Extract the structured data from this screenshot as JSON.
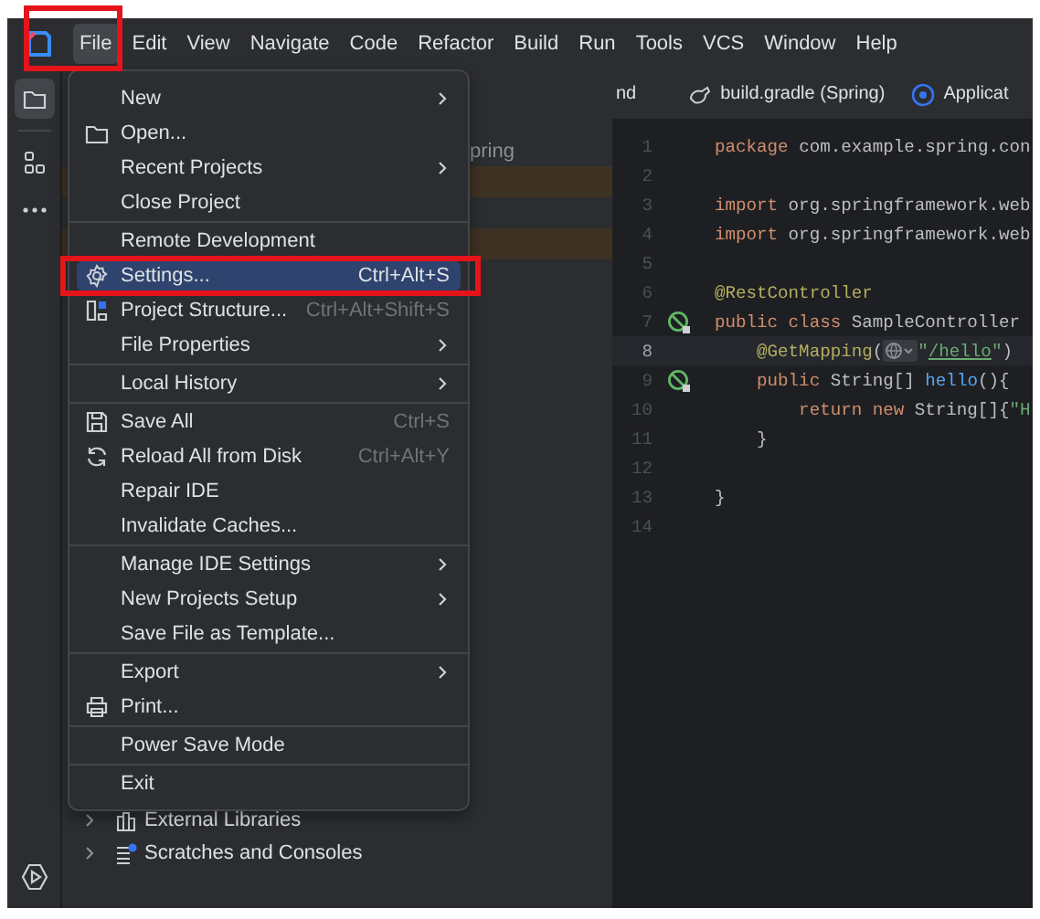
{
  "menubar": {
    "items": [
      {
        "label": "File",
        "selected": true
      },
      {
        "label": "Edit",
        "selected": false
      },
      {
        "label": "View",
        "selected": false
      },
      {
        "label": "Navigate",
        "selected": false
      },
      {
        "label": "Code",
        "selected": false
      },
      {
        "label": "Refactor",
        "selected": false
      },
      {
        "label": "Build",
        "selected": false
      },
      {
        "label": "Run",
        "selected": false
      },
      {
        "label": "Tools",
        "selected": false
      },
      {
        "label": "VCS",
        "selected": false
      },
      {
        "label": "Window",
        "selected": false
      },
      {
        "label": "Help",
        "selected": false
      }
    ]
  },
  "file_menu": {
    "items": [
      {
        "kind": "item",
        "label": "New",
        "submenu": true,
        "selected": false
      },
      {
        "kind": "item",
        "label": "Open...",
        "submenu": false,
        "selected": false
      },
      {
        "kind": "item",
        "label": "Recent Projects",
        "submenu": true,
        "selected": false
      },
      {
        "kind": "item",
        "label": "Close Project",
        "submenu": false,
        "selected": false
      },
      {
        "kind": "separator"
      },
      {
        "kind": "item",
        "label": "Remote Development",
        "submenu": false,
        "selected": false
      },
      {
        "kind": "item",
        "label": "Settings...",
        "shortcut": "Ctrl+Alt+S",
        "submenu": false,
        "selected": true
      },
      {
        "kind": "item",
        "label": "Project Structure...",
        "shortcut": "Ctrl+Alt+Shift+S",
        "submenu": false,
        "selected": false
      },
      {
        "kind": "item",
        "label": "File Properties",
        "submenu": true,
        "selected": false
      },
      {
        "kind": "separator"
      },
      {
        "kind": "item",
        "label": "Local History",
        "submenu": true,
        "selected": false
      },
      {
        "kind": "separator"
      },
      {
        "kind": "item",
        "label": "Save All",
        "shortcut": "Ctrl+S",
        "submenu": false,
        "selected": false
      },
      {
        "kind": "item",
        "label": "Reload All from Disk",
        "shortcut": "Ctrl+Alt+Y",
        "submenu": false,
        "selected": false
      },
      {
        "kind": "item",
        "label": "Repair IDE",
        "submenu": false,
        "selected": false
      },
      {
        "kind": "item",
        "label": "Invalidate Caches...",
        "submenu": false,
        "selected": false
      },
      {
        "kind": "separator"
      },
      {
        "kind": "item",
        "label": "Manage IDE Settings",
        "submenu": true,
        "selected": false
      },
      {
        "kind": "item",
        "label": "New Projects Setup",
        "submenu": true,
        "selected": false
      },
      {
        "kind": "item",
        "label": "Save File as Template...",
        "submenu": false,
        "selected": false
      },
      {
        "kind": "separator"
      },
      {
        "kind": "item",
        "label": "Export",
        "submenu": true,
        "selected": false
      },
      {
        "kind": "item",
        "label": "Print...",
        "submenu": false,
        "selected": false
      },
      {
        "kind": "separator"
      },
      {
        "kind": "item",
        "label": "Power Save Mode",
        "submenu": false,
        "selected": false
      },
      {
        "kind": "separator"
      },
      {
        "kind": "item",
        "label": "Exit",
        "submenu": false,
        "selected": false
      }
    ]
  },
  "project_tree": {
    "rows": [
      {
        "label": "pring",
        "highlighted": false
      },
      {
        "highlighted": true
      },
      {
        "highlighted": false
      },
      {
        "highlighted": true
      }
    ],
    "bottom_rows": [
      {
        "label": "External Libraries",
        "expanded": false
      },
      {
        "label": "Scratches and Consoles",
        "expanded": false
      }
    ]
  },
  "editor": {
    "tabs": [
      {
        "label": "nd",
        "selected": false
      },
      {
        "label": "build.gradle (Spring)",
        "selected": false
      },
      {
        "label": "Applicat",
        "selected": false
      }
    ],
    "lines": [
      {
        "number": "1",
        "current": false,
        "marker": false,
        "tokens": [
          {
            "kind": "keyword",
            "text": "package"
          },
          {
            "kind": "plain",
            "text": " com.example.spring.con"
          }
        ]
      },
      {
        "number": "2",
        "current": false,
        "marker": false
      },
      {
        "number": "3",
        "current": false,
        "marker": false,
        "tokens": [
          {
            "kind": "keyword",
            "text": "import"
          },
          {
            "kind": "plain",
            "text": " org.springframework.web"
          }
        ]
      },
      {
        "number": "4",
        "current": false,
        "marker": false,
        "tokens": [
          {
            "kind": "keyword",
            "text": "import"
          },
          {
            "kind": "plain",
            "text": " org.springframework.web"
          }
        ]
      },
      {
        "number": "5",
        "current": false,
        "marker": false
      },
      {
        "number": "6",
        "current": false,
        "marker": false,
        "tokens": [
          {
            "kind": "annotation",
            "text": "@RestController"
          }
        ]
      },
      {
        "number": "7",
        "current": false,
        "marker": true,
        "tokens": [
          {
            "kind": "keyword",
            "text": "public class "
          },
          {
            "kind": "plain",
            "text": "SampleController"
          }
        ]
      },
      {
        "number": "8",
        "current": true,
        "marker": false,
        "tokens": [
          {
            "kind": "annotation",
            "text": "    @GetMapping"
          },
          {
            "kind": "plain",
            "text": "("
          },
          {
            "kind": "inlay"
          },
          {
            "kind": "string",
            "text": "\""
          },
          {
            "kind": "link",
            "text": "/hello"
          },
          {
            "kind": "string",
            "text": "\""
          },
          {
            "kind": "plain",
            "text": ")"
          }
        ]
      },
      {
        "number": "9",
        "current": false,
        "marker": true,
        "tokens": [
          {
            "kind": "keyword",
            "text": "    public "
          },
          {
            "kind": "plain",
            "text": "String[] "
          },
          {
            "kind": "method",
            "text": "hello"
          },
          {
            "kind": "plain",
            "text": "(){"
          }
        ]
      },
      {
        "number": "10",
        "current": false,
        "marker": false,
        "tokens": [
          {
            "kind": "keyword",
            "text": "        return new "
          },
          {
            "kind": "plain",
            "text": "String[]{"
          },
          {
            "kind": "string",
            "text": "\"H"
          }
        ]
      },
      {
        "number": "11",
        "current": false,
        "marker": false,
        "tokens": [
          {
            "kind": "plain",
            "text": "    }"
          }
        ]
      },
      {
        "number": "12",
        "current": false,
        "marker": false
      },
      {
        "number": "13",
        "current": false,
        "marker": false,
        "tokens": [
          {
            "kind": "plain",
            "text": "}"
          }
        ]
      },
      {
        "number": "14",
        "current": false,
        "marker": false
      }
    ]
  }
}
